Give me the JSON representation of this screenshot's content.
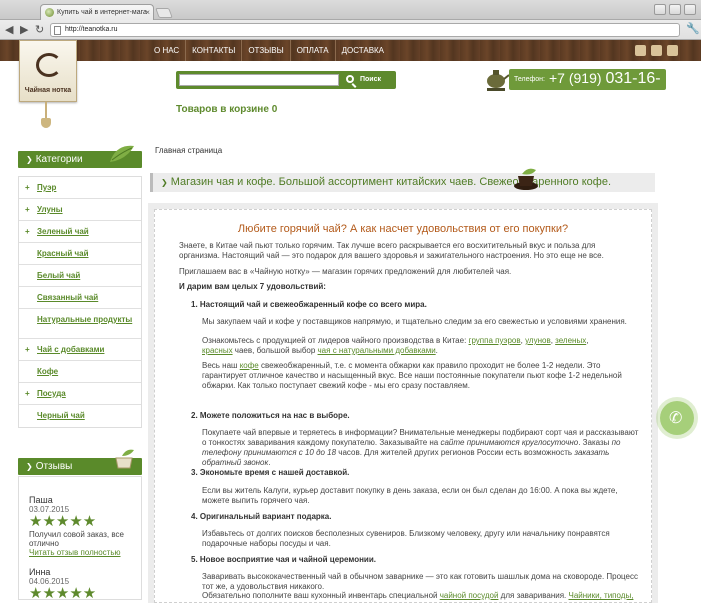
{
  "browser": {
    "tab_title": "Купить чай в интернет-мага",
    "tab_close": "×",
    "url": "http://teanotka.ru",
    "back": "◀",
    "forward": "▶",
    "reload": "↻",
    "menu": "🔧"
  },
  "header": {
    "nav": [
      "О НАС",
      "КОНТАКТЫ",
      "ОТЗЫВЫ",
      "ОПЛАТА",
      "ДОСТАВКА"
    ],
    "logo_name": "Чайная нотка",
    "search_placeholder": "",
    "search_button": "Поиск",
    "cart": "Товаров в корзине 0",
    "phone_label": "Телефон:",
    "phone_prefix": "+7 (919)",
    "phone_number": "031-16-50"
  },
  "sidebar": {
    "categories_title": "Категории",
    "items": [
      {
        "label": "Пуэр",
        "plus": "+"
      },
      {
        "label": "Улуны",
        "plus": "+"
      },
      {
        "label": "Зеленый чай",
        "plus": "+"
      },
      {
        "label": "Красный чай",
        "plus": ""
      },
      {
        "label": "Белый чай",
        "plus": ""
      },
      {
        "label": "Связанный чай",
        "plus": ""
      },
      {
        "label": "Натуральные продукты",
        "plus": ""
      },
      {
        "label": "Чай с добавками",
        "plus": "+"
      },
      {
        "label": "Кофе",
        "plus": ""
      },
      {
        "label": "Посуда",
        "plus": "+"
      },
      {
        "label": "Черный чай",
        "plus": ""
      }
    ],
    "reviews_title": "Отзывы",
    "reviews": [
      {
        "name": "Паша",
        "date": "03.07.2015",
        "rating": 5,
        "text": "Получил совой заказ, все отлично",
        "link": "Читать отзыв полностью"
      },
      {
        "name": "Инна",
        "date": "04.06.2015",
        "rating": 5
      }
    ]
  },
  "main": {
    "breadcrumb": "Главная страница",
    "banner": "Магазин чая и кофе. Большой ассортимент китайских чаев. Свежеобжаренного кофе.",
    "title": "Любите горячий чай? А как насчет удовольствия от его покупки?",
    "intro1": "Знаете, в Китае чай пьют только горячим. Так лучше всего раскрывается его восхитительный вкус и польза для организма. Настоящий чай — это подарок для вашего здоровья и зажигательного настроения. Но это еще не все.",
    "intro2": "Приглашаем вас в «Чайную нотку» — магазин горячих предложений для любителей чая.",
    "reasons_head": "И дарим вам целых 7 удовольствий:",
    "r1_title": "1.  Настоящий чай и свежеобжаренный кофе со всего мира.",
    "r1_p1": "Мы закупаем чай и кофе у поставщиков напрямую, и тщательно следим за его свежестью и условиями хранения.",
    "r1_p2a": "Ознакомьтесь с продукцией от лидеров чайного производства в Китае: ",
    "r1_p2_link1": "группа пуэров",
    "r1_p2_sep1": ", ",
    "r1_p2_link2": "улунов",
    "r1_p2_sep2": ", ",
    "r1_p2_link3": "зеленых",
    "r1_p2_sep3": ",",
    "r1_p2_link4": "красных",
    "r1_p2b": " чаев, большой выбор ",
    "r1_p2_link5": "чая с натуральными добавками",
    "r1_p2c": ".",
    "r1_p3a": "Весь наш ",
    "r1_p3_link": "кофе",
    "r1_p3b": " свежеобжаренный, т.е. с момента обжарки как правило проходит не более 1-2 недели. Это гарантирует отличное качество и насыщенный вкус. Все наши постоянные покупатели пьют кофе 1-2 недельной обжарки. Как только поступает свежий кофе - мы его сразу поставляем.",
    "r2_title": "2.  Можете положиться на нас в выборе.",
    "r2_p_a": "Покупаете чай впервые и теряетесь в информации? Внимательные менеджеры подбирают сорт чая и рассказывают о тонкостях заваривания каждому покупателю. Заказывайте на ",
    "r2_p_it1": "сайте принимаются круглосуточно",
    "r2_p_b": ". Заказы ",
    "r2_p_it2": "по телефону принимаются с 10 до 18",
    "r2_p_c": "  часов. Для жителей других регионов России есть возможность ",
    "r2_p_it3": "заказать обратный звонок",
    "r2_p_d": ".",
    "r3_title": "3.  Экономьте время с нашей доставкой.",
    "r3_p": "Если вы житель Калуги, курьер доставит покупку в день заказа, если он был сделан до 16:00. А пока вы ждете, можете выпить горячего чая.",
    "r4_title": "4.  Оригинальный вариант подарка.",
    "r4_p": "Избавьтесь от долгих поисков бесполезных сувениров. Близкому человеку, другу или начальнику понравятся подарочные наборы посуды и чая.",
    "r5_title": "5.  Новое восприятие чая и чайной церемонии.",
    "r5_p1": "Заваривать высококачественный чай в обычном заварнике — это как готовить шашлык дома на сковороде. Процесс тот же, а удовольствия никакого.",
    "r5_p2a": "Обязательно пополните ваш кухонный инвентарь специальной ",
    "r5_p2_link1": "чайной посудой",
    "r5_p2b": " для заваривания. ",
    "r5_p2_link2": "Чайники, типоды,"
  },
  "colors": {
    "accent": "#5a8a2a",
    "title": "#b35a1a",
    "wood": "#5a3a22"
  }
}
